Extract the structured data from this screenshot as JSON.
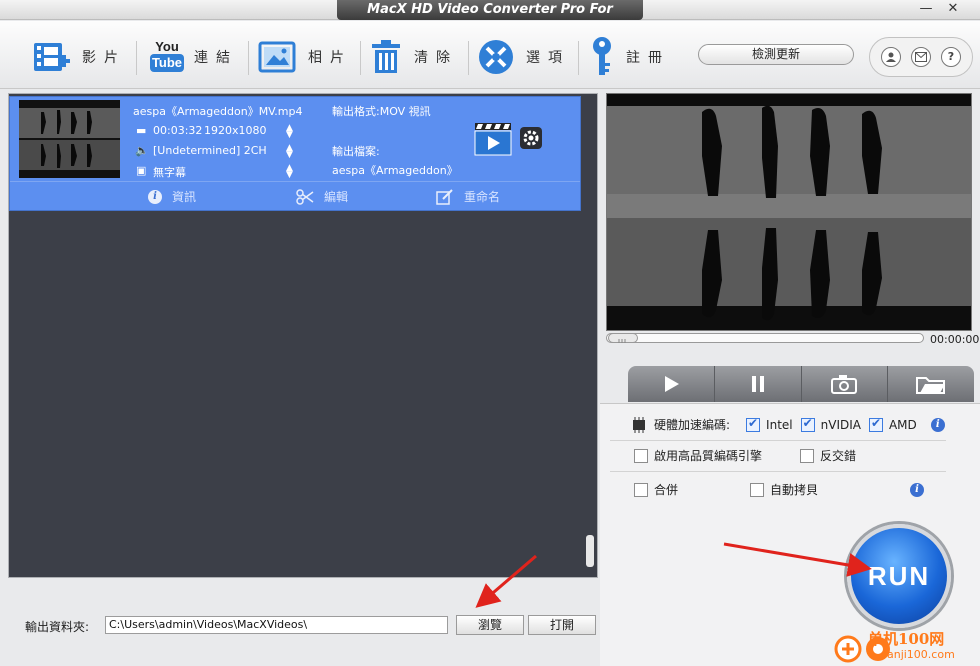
{
  "window": {
    "title": "MacX HD Video Converter Pro For Windows",
    "minimize_glyph": "—",
    "close_glyph": "✕"
  },
  "toolbar": {
    "items": [
      {
        "label": "影片",
        "icon": "film-add-icon"
      },
      {
        "label": "連結",
        "icon": "youtube-icon",
        "icon_text_top": "You",
        "icon_text_bottom": "Tube"
      },
      {
        "label": "相片",
        "icon": "photo-icon"
      },
      {
        "label": "清除",
        "icon": "trash-icon"
      },
      {
        "label": "選項",
        "icon": "tools-icon"
      },
      {
        "label": "註冊",
        "icon": "key-icon"
      }
    ],
    "check_update_label": "檢測更新",
    "right_icons": [
      "user-icon",
      "mail-icon",
      "help-icon"
    ],
    "help_glyph": "?"
  },
  "file_item": {
    "filename": "aespa《Armageddon》MV.mp4",
    "duration": "00:03:32",
    "resolution": "1920x1080",
    "audio": "[Undetermined] 2CH",
    "subtitle": "無字幕",
    "output_format": "輸出格式:MOV 視訊",
    "output_file_label": "輸出檔案:",
    "output_file_name": "aespa《Armageddon》MV",
    "actions": {
      "info": "資訊",
      "edit": "編輯",
      "rename": "重命名"
    },
    "info_glyph": "i"
  },
  "player": {
    "time": "00:00:00",
    "progress": 0,
    "controls": [
      "play-icon",
      "pause-icon",
      "camera-icon",
      "folder-icon"
    ]
  },
  "options": {
    "hw_accel_label": "硬體加速編碼:",
    "intel_label": "Intel",
    "intel_checked": true,
    "nvidia_label": "nVIDIA",
    "nvidia_checked": true,
    "amd_label": "AMD",
    "amd_checked": true,
    "hq_engine_label": "啟用高品質編碼引擎",
    "hq_engine_checked": false,
    "deinterlace_label": "反交錯",
    "deinterlace_checked": false,
    "merge_label": "合併",
    "merge_checked": false,
    "autocopy_label": "自動拷貝",
    "autocopy_checked": false,
    "info_glyph": "i"
  },
  "run_button_label": "RUN",
  "output": {
    "folder_label": "輸出資料夾:",
    "folder_path": "C:\\Users\\admin\\Videos\\MacXVideos\\",
    "browse_label": "瀏覽",
    "open_label": "打開"
  },
  "watermark": {
    "text": "单机100网",
    "url": "danji100.com"
  },
  "colors": {
    "item_selected": "#5c8ff0",
    "list_bg": "#3c3f48",
    "run_blue": "#1a67d8",
    "arrow_red": "#e0231c",
    "watermark_orange": "#ff7a1a"
  }
}
